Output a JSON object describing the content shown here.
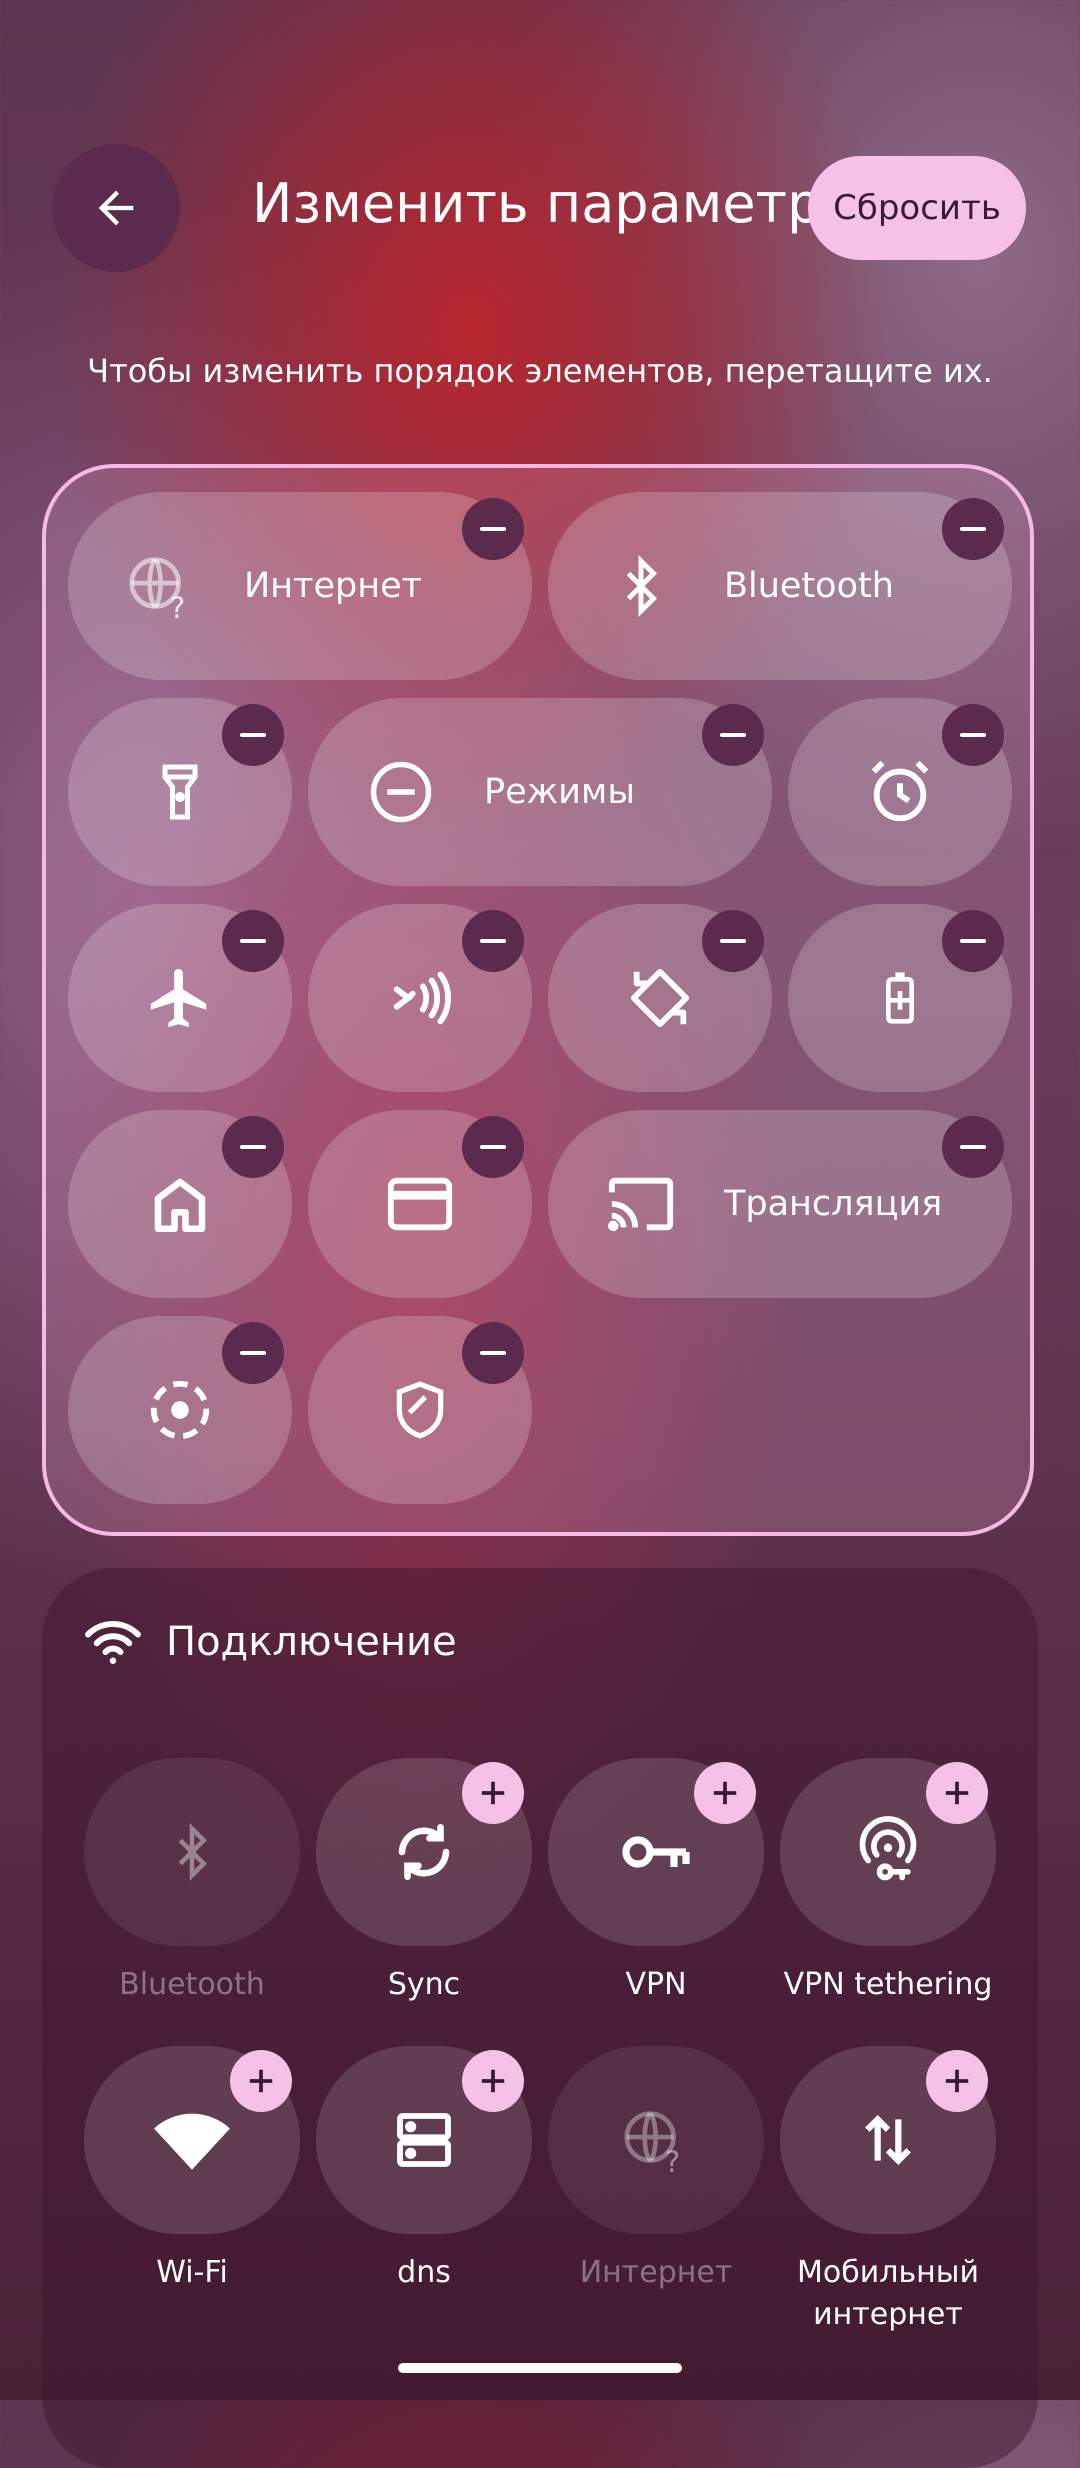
{
  "header": {
    "title": "Изменить параметры",
    "reset_label": "Сбросить",
    "hint": "Чтобы изменить порядок элементов, перетащите их."
  },
  "active_tiles": [
    {
      "name": "internet",
      "label": "Интернет",
      "icon": "globe-question-icon"
    },
    {
      "name": "bluetooth",
      "label": "Bluetooth",
      "icon": "bluetooth-icon"
    },
    {
      "name": "flashlight",
      "icon": "flashlight-icon"
    },
    {
      "name": "modes",
      "label": "Режимы",
      "icon": "do-not-disturb-icon"
    },
    {
      "name": "alarm",
      "icon": "alarm-icon"
    },
    {
      "name": "airplane",
      "icon": "airplane-icon"
    },
    {
      "name": "nfc",
      "icon": "nfc-icon"
    },
    {
      "name": "auto-rotate",
      "icon": "rotate-icon"
    },
    {
      "name": "battery-saver",
      "icon": "battery-plus-icon"
    },
    {
      "name": "home",
      "icon": "home-icon"
    },
    {
      "name": "wallet",
      "icon": "card-icon"
    },
    {
      "name": "cast",
      "label": "Трансляция",
      "icon": "cast-icon"
    },
    {
      "name": "screen-record",
      "icon": "screen-record-icon"
    },
    {
      "name": "security",
      "icon": "shield-icon"
    }
  ],
  "available": {
    "section_title": "Подключение",
    "section_icon": "wifi-icon",
    "tiles": [
      {
        "label": "Bluetooth",
        "icon": "bluetooth-icon",
        "enabled": false
      },
      {
        "label": "Sync",
        "icon": "sync-icon",
        "enabled": true
      },
      {
        "label": "VPN",
        "icon": "key-icon",
        "enabled": true
      },
      {
        "label": "VPN tethering",
        "icon": "hotspot-key-icon",
        "enabled": true
      },
      {
        "label": "Wi-Fi",
        "icon": "wifi-icon",
        "enabled": true
      },
      {
        "label": "dns",
        "icon": "server-icon",
        "enabled": true
      },
      {
        "label": "Интернет",
        "icon": "globe-question-icon",
        "enabled": false
      },
      {
        "label_line1": "Мобильный",
        "label_line2": "интернет",
        "icon": "mobile-data-icon",
        "enabled": true
      }
    ]
  },
  "colors": {
    "accent_pink": "#f6c1e7",
    "dark_plum": "#5b2a4c"
  }
}
